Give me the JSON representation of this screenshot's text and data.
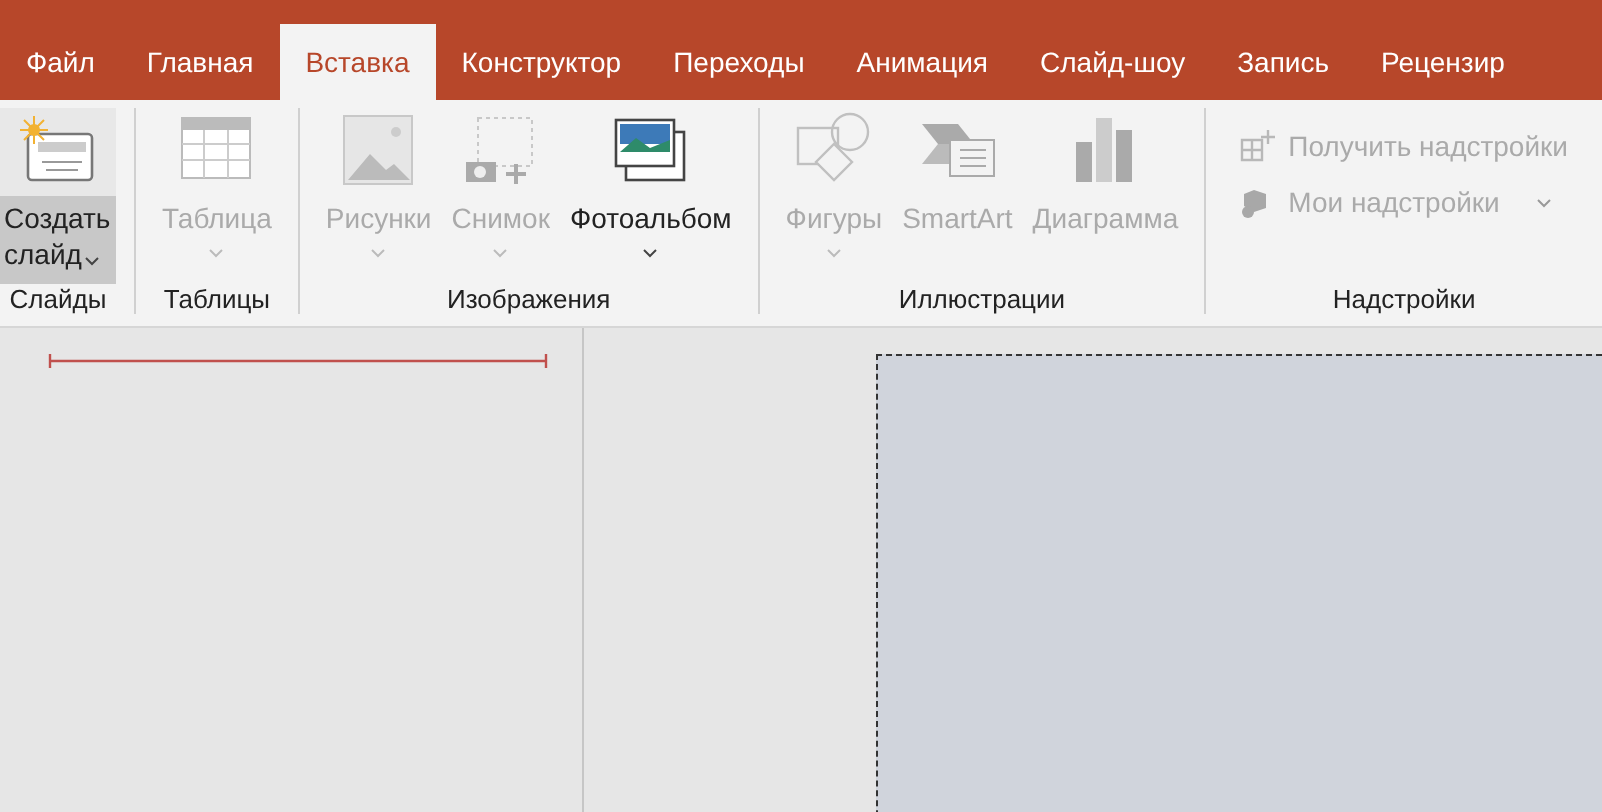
{
  "tabs": [
    {
      "label": "Файл",
      "selected": false
    },
    {
      "label": "Главная",
      "selected": false
    },
    {
      "label": "Вставка",
      "selected": true
    },
    {
      "label": "Конструктор",
      "selected": false
    },
    {
      "label": "Переходы",
      "selected": false
    },
    {
      "label": "Анимация",
      "selected": false
    },
    {
      "label": "Слайд-шоу",
      "selected": false
    },
    {
      "label": "Запись",
      "selected": false
    },
    {
      "label": "Рецензир",
      "selected": false
    }
  ],
  "ribbon_groups": [
    {
      "label": "Слайды",
      "buttons": [
        {
          "kind": "new-slide",
          "label": "Создать слайд",
          "disabled": false,
          "dropdown": true,
          "hover": true
        }
      ]
    },
    {
      "label": "Таблицы",
      "buttons": [
        {
          "kind": "table",
          "label": "Таблица",
          "disabled": true,
          "dropdown": true,
          "hover": false
        }
      ]
    },
    {
      "label": "Изображения",
      "buttons": [
        {
          "kind": "picture",
          "label": "Рисунки",
          "disabled": true,
          "dropdown": true,
          "hover": false
        },
        {
          "kind": "screenshot",
          "label": "Снимок",
          "disabled": true,
          "dropdown": true,
          "hover": false
        },
        {
          "kind": "album",
          "label": "Фотоальбом",
          "disabled": false,
          "dropdown": true,
          "hover": false
        }
      ]
    },
    {
      "label": "Иллюстрации",
      "buttons": [
        {
          "kind": "shapes",
          "label": "Фигуры",
          "disabled": true,
          "dropdown": true,
          "hover": false
        },
        {
          "kind": "smartart",
          "label": "SmartArt",
          "disabled": true,
          "dropdown": false,
          "hover": false
        },
        {
          "kind": "chart",
          "label": "Диаграмма",
          "disabled": true,
          "dropdown": false,
          "hover": false
        }
      ]
    },
    {
      "label": "Надстройки",
      "buttons": [
        {
          "kind": "store",
          "label": "Получить надстройки",
          "disabled": true,
          "dropdown": false,
          "hover": false
        },
        {
          "kind": "addins",
          "label": "Мои надстройки",
          "disabled": true,
          "dropdown": true,
          "hover": false
        }
      ]
    }
  ]
}
